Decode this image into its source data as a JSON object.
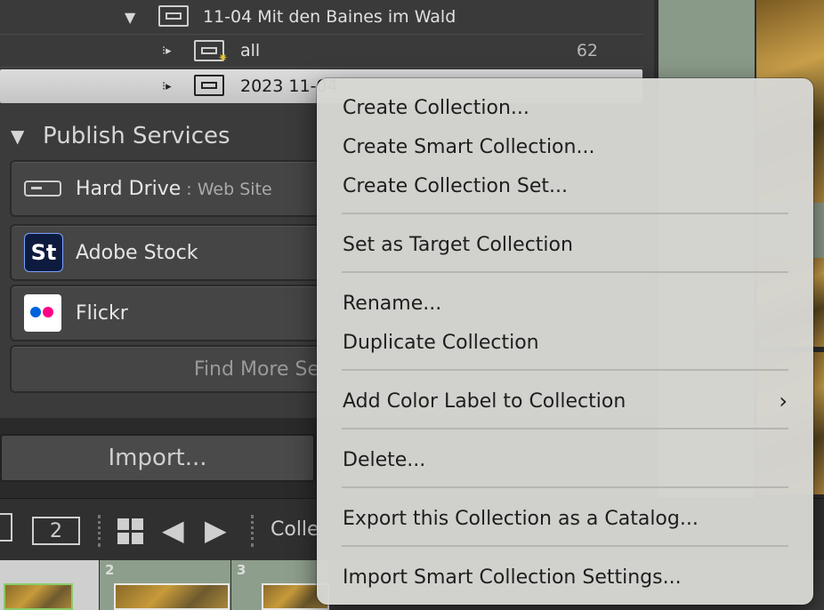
{
  "tree": {
    "row1_label": "11-04 Mit den Baines im Wald",
    "row2_label": "all",
    "row2_count": "62",
    "row3_label": "2023 11-04"
  },
  "publish": {
    "header": "Publish Services",
    "services": [
      {
        "name": "Hard Drive",
        "sub": ": Web Site",
        "icon": "hard-drive-icon"
      },
      {
        "name": "Adobe Stock",
        "icon": "adobe-stock-icon",
        "icon_text": "St"
      },
      {
        "name": "Flickr",
        "icon": "flickr-icon"
      }
    ],
    "find_more": "Find More Se"
  },
  "import_label": "Import...",
  "toolbar": {
    "page_number": "2",
    "collection_label": "Colle"
  },
  "filmstrip": {
    "numbers": [
      "2",
      "3"
    ]
  },
  "menu": {
    "items": [
      "Create Collection...",
      "Create Smart Collection...",
      "Create Collection Set...",
      "Set as Target Collection",
      "Rename...",
      "Duplicate Collection",
      "Add Color Label to Collection",
      "Delete...",
      "Export this Collection as a Catalog...",
      "Import Smart Collection Settings..."
    ],
    "submenu_indicator": "›"
  }
}
